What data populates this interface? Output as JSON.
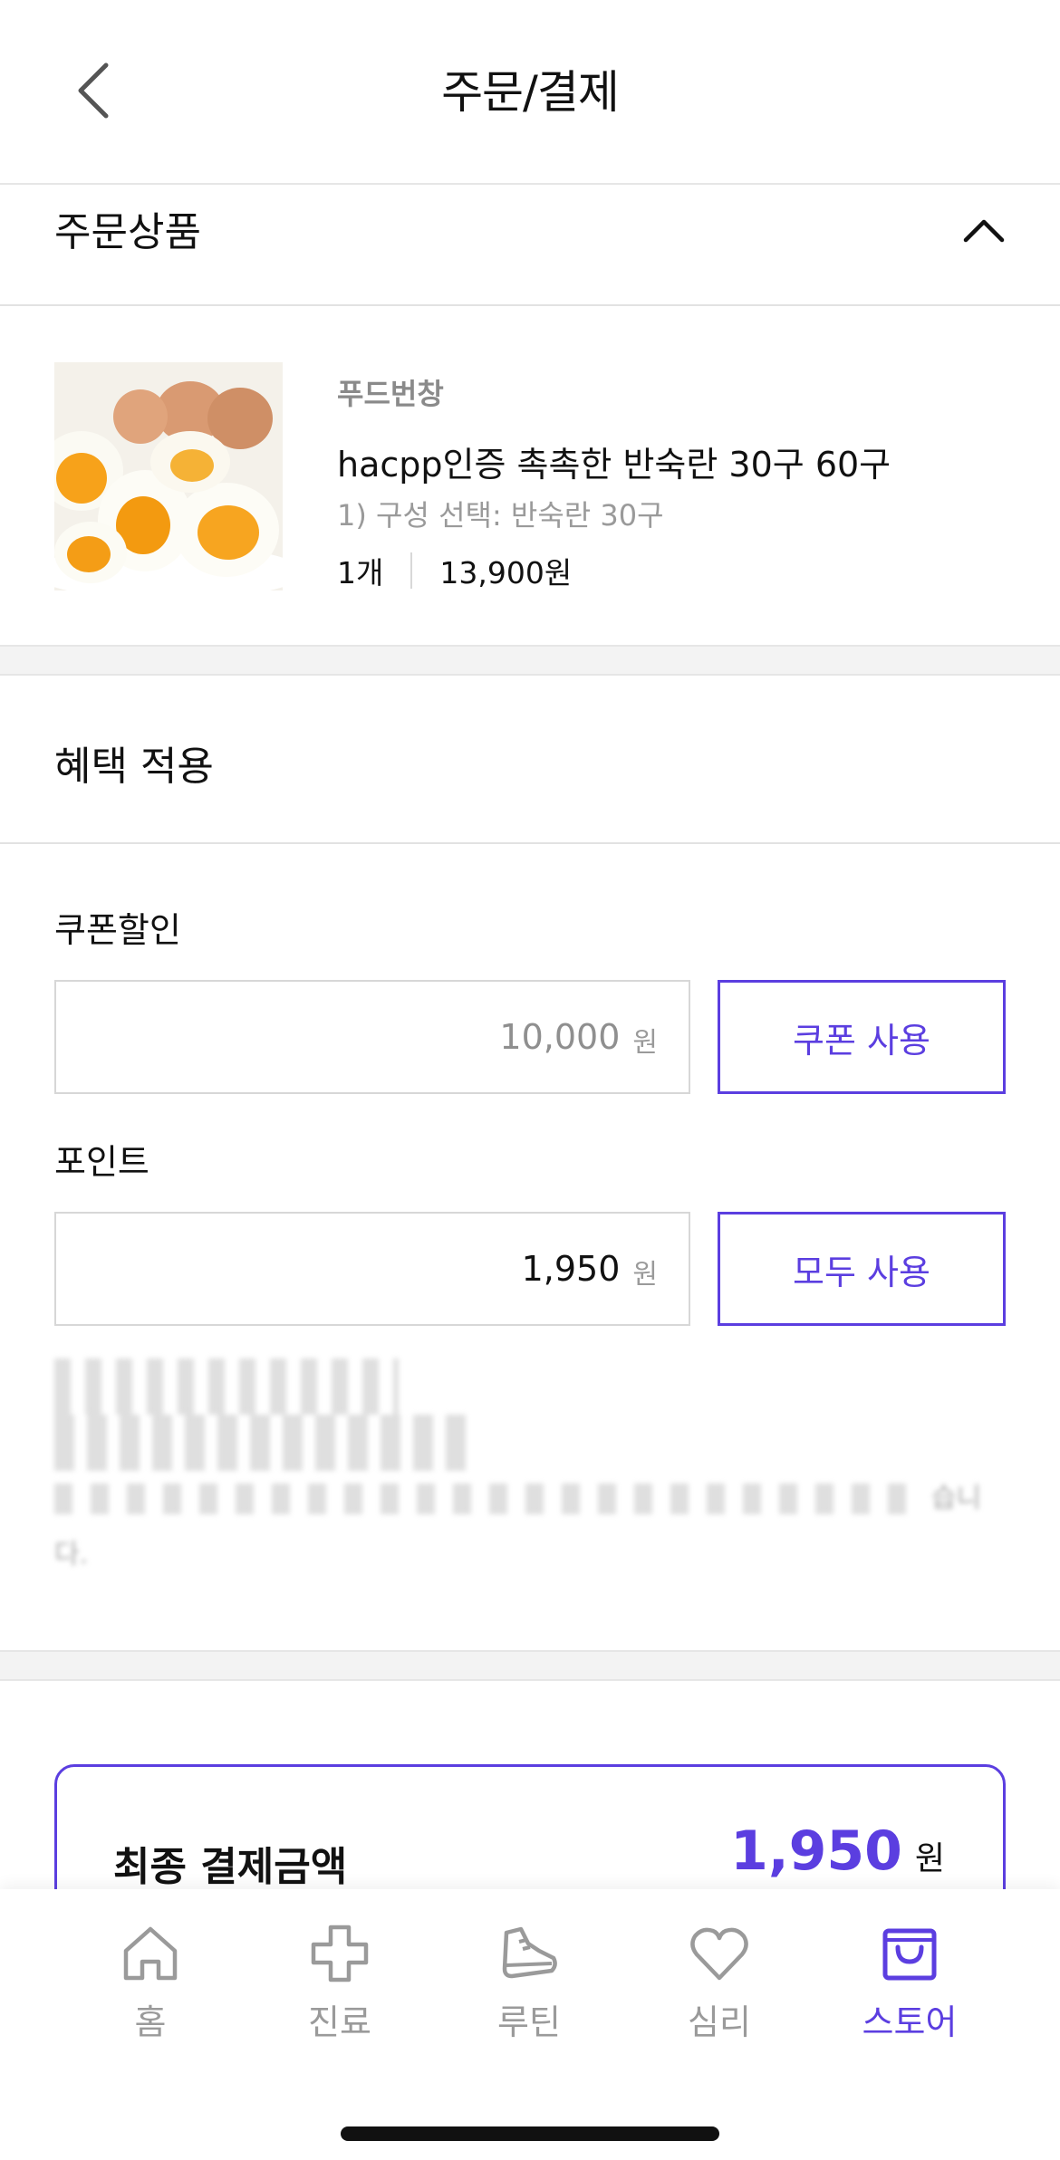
{
  "header": {
    "title": "주문/결제"
  },
  "order": {
    "title": "주문상품",
    "product": {
      "brand": "푸드번창",
      "name": "hacpp인증 촉촉한 반숙란 30구 60구",
      "option": "1) 구성 선택: 반숙란 30구",
      "quantity": "1개",
      "price": "13,900원"
    }
  },
  "benefit": {
    "title": "혜택 적용",
    "coupon": {
      "label": "쿠폰할인",
      "value": "10,000",
      "unit": "원",
      "button": "쿠폰 사용"
    },
    "point": {
      "label": "포인트",
      "value": "1,950",
      "unit": "원",
      "button": "모두 사용"
    },
    "notice_tail": "습니",
    "notice_tail2": "다."
  },
  "final": {
    "label": "최종 결제금액",
    "value": "1,950",
    "unit": "원"
  },
  "tabs": [
    {
      "label": "홈",
      "icon": "home-icon"
    },
    {
      "label": "진료",
      "icon": "plus-icon"
    },
    {
      "label": "루틴",
      "icon": "sneaker-icon"
    },
    {
      "label": "심리",
      "icon": "heart-icon"
    },
    {
      "label": "스토어",
      "icon": "shopping-bag-icon",
      "active": true
    }
  ],
  "colors": {
    "accent": "#5b3ee0",
    "muted": "#9a9a9a",
    "divider": "#e6e6e6"
  }
}
